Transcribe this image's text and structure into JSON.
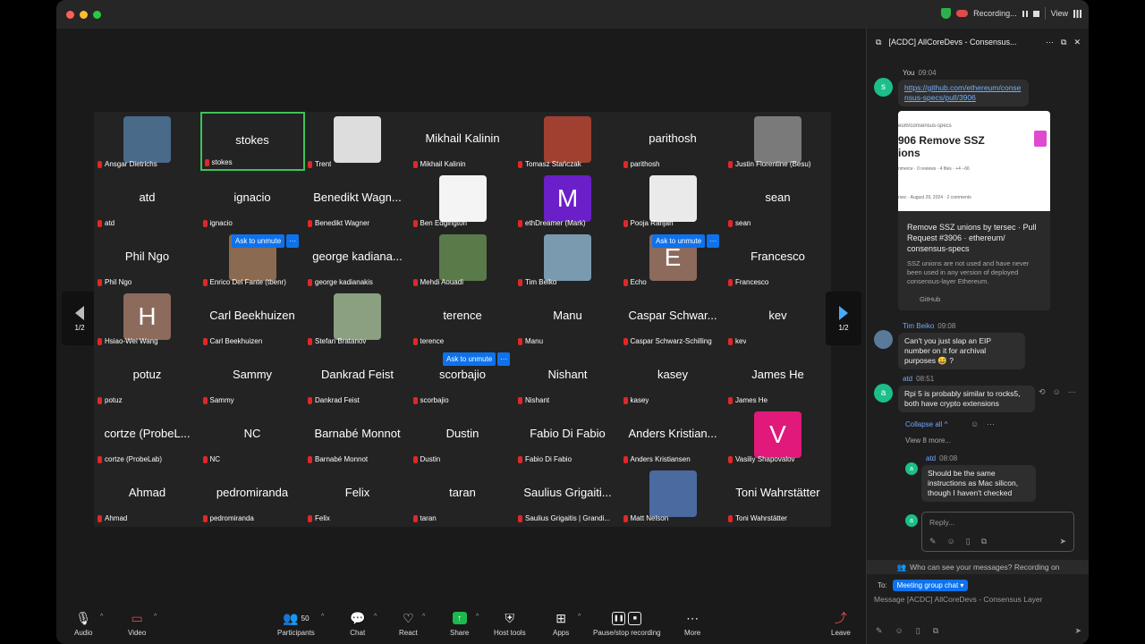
{
  "titlebar": {
    "recording": "Recording...",
    "view": "View"
  },
  "gallery": {
    "page_indicator": "1/2",
    "ask_to_unmute": "Ask to unmute",
    "tiles": [
      {
        "label": "Ansgar Dietrichs",
        "avatar": "photo",
        "color": "#4a6a8a"
      },
      {
        "label": "stokes",
        "name": "stokes",
        "active": true
      },
      {
        "label": "Trent",
        "avatar": "photo",
        "color": "#ddd"
      },
      {
        "label": "Mikhail Kalinin",
        "name": "Mikhail Kalinin"
      },
      {
        "label": "Tomasz Stańczak",
        "avatar": "photo",
        "color": "#a04030"
      },
      {
        "label": "parithosh",
        "name": "parithosh"
      },
      {
        "label": "Justin Florentine (Besu)",
        "avatar": "photo",
        "color": "#7a7a7a"
      },
      {
        "label": "atd",
        "name": "atd"
      },
      {
        "label": "ignacio",
        "name": "ignacio"
      },
      {
        "label": "Benedikt Wagner",
        "name": "Benedikt Wagn..."
      },
      {
        "label": "Ben Edgington",
        "avatar": "photo",
        "color": "#f4f4f4"
      },
      {
        "label": "ethDreamer (Mark)",
        "avatar": "letter",
        "letter": "M",
        "color": "#6a1fc9"
      },
      {
        "label": "Pooja Ranjan",
        "avatar": "photo",
        "color": "#eaeaea"
      },
      {
        "label": "sean",
        "name": "sean"
      },
      {
        "label": "Phil Ngo",
        "name": "Phil Ngo"
      },
      {
        "label": "Enrico Del Fante (tbenr)",
        "avatar": "photo",
        "color": "#8a6a50"
      },
      {
        "label": "george kadianakis",
        "name": "george kadiana..."
      },
      {
        "label": "Mehdi Aouadi",
        "avatar": "photo",
        "color": "#5a7a4a"
      },
      {
        "label": "Tim Beiko",
        "avatar": "photo",
        "color": "#7a9ab0"
      },
      {
        "label": "Echo",
        "avatar": "letter",
        "letter": "E",
        "color": "#8c6a5c"
      },
      {
        "label": "Francesco",
        "name": "Francesco"
      },
      {
        "label": "Hsiao-Wei Wang",
        "avatar": "letter",
        "letter": "H",
        "color": "#8c6a5c"
      },
      {
        "label": "Carl Beekhuizen",
        "name": "Carl Beekhuizen"
      },
      {
        "label": "Stefan Bratanov",
        "avatar": "photo",
        "color": "#8aa080"
      },
      {
        "label": "terence",
        "name": "terence"
      },
      {
        "label": "Manu",
        "name": "Manu"
      },
      {
        "label": "Caspar Schwarz-Schilling",
        "name": "Caspar Schwar..."
      },
      {
        "label": "kev",
        "name": "kev"
      },
      {
        "label": "potuz",
        "name": "potuz"
      },
      {
        "label": "Sammy",
        "name": "Sammy"
      },
      {
        "label": "Dankrad Feist",
        "name": "Dankrad Feist"
      },
      {
        "label": "scorbajio",
        "name": "scorbajio"
      },
      {
        "label": "Nishant",
        "name": "Nishant"
      },
      {
        "label": "kasey",
        "name": "kasey"
      },
      {
        "label": "James He",
        "name": "James He"
      },
      {
        "label": "cortze (ProbeLab)",
        "name": "cortze (ProbeL..."
      },
      {
        "label": "NC",
        "name": "NC"
      },
      {
        "label": "Barnabé Monnot",
        "name": "Barnabé Monnot"
      },
      {
        "label": "Dustin",
        "name": "Dustin"
      },
      {
        "label": "Fabio Di Fabio",
        "name": "Fabio Di Fabio"
      },
      {
        "label": "Anders Kristiansen",
        "name": "Anders Kristian..."
      },
      {
        "label": "Vasiliy Shapovalov",
        "avatar": "letter",
        "letter": "V",
        "color": "#e0197a"
      },
      {
        "label": "Ahmad",
        "name": "Ahmad"
      },
      {
        "label": "pedromiranda",
        "name": "pedromiranda"
      },
      {
        "label": "Felix",
        "name": "Felix"
      },
      {
        "label": "taran",
        "name": "taran"
      },
      {
        "label": "Saulius Grigaitis | Grandi...",
        "name": "Saulius Grigaiti..."
      },
      {
        "label": "Matt Nelson",
        "avatar": "photo",
        "color": "#4a6aa0"
      },
      {
        "label": "Toni Wahrstätter",
        "name": "Toni Wahrstätter"
      }
    ]
  },
  "toolbar": {
    "audio": "Audio",
    "video": "Video",
    "participants": "Participants",
    "participants_count": "50",
    "chat": "Chat",
    "react": "React",
    "share": "Share",
    "host_tools": "Host tools",
    "apps": "Apps",
    "record": "Pause/stop recording",
    "more": "More",
    "leave": "Leave"
  },
  "chat": {
    "title": "[ACDC] AllCoreDevs - Consensus...",
    "msg1": {
      "sender": "You",
      "time": "09:04",
      "avatar": "s",
      "link": "https://github.com/ethereum/consensus-specs/pull/3906"
    },
    "preview": {
      "img_path": "eum/consensus-specs",
      "img_title": "906 Remove SSZ ions",
      "img_meta": "nmerce · 0 reviews · 4 files · +4 −66",
      "img_meta2": "rsec · August 29, 2024 · 2 comments",
      "title": "Remove SSZ unions by tersec · Pull Request #3906 · ethereum/ consensus-specs",
      "desc": "SSZ unions are not used and have never been used in any version of deployed consensus-layer Ethereum.",
      "site": "GitHub"
    },
    "msg2": {
      "sender": "Tim Beiko",
      "time": "09:08",
      "text": "Can't you just slap an EIP number on it for archival purposes 😅 ?"
    },
    "msg3": {
      "sender": "atd",
      "time": "08:51",
      "avatar": "a",
      "text": "Rpi 5 is probably similar to rocks5, both have crypto extensions"
    },
    "collapse": "Collapse all",
    "view_more": "View 8 more...",
    "reply": {
      "sender": "atd",
      "time": "08:08",
      "avatar": "a",
      "text": "Should be the same instructions as Mac silicon, though I haven't checked"
    },
    "reply_placeholder": "Reply...",
    "notice": "Who can see your messages? Recording on",
    "to_label": "To:",
    "to_value": "Meeting group chat",
    "compose_placeholder": "Message [ACDC] AllCoreDevs - Consensus Layer"
  }
}
